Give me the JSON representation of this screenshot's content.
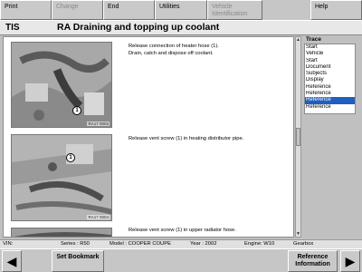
{
  "toolbar": {
    "buttons": [
      {
        "label": "Print",
        "enabled": true
      },
      {
        "label": "Change",
        "enabled": false
      },
      {
        "label": "End",
        "enabled": true
      },
      {
        "label": "Utilities",
        "enabled": true
      },
      {
        "label": "Vehicle Identification",
        "enabled": false
      },
      {
        "label": "Help",
        "enabled": true
      }
    ]
  },
  "header": {
    "app": "TIS",
    "title": "RA  Draining and topping up coolant"
  },
  "steps": [
    {
      "text": "Release connection of heater hose (1).\nDrain, catch and dispose off coolant.",
      "callout": "1",
      "ref": "RA17 0003"
    },
    {
      "text": "Release vent screw (1) in heating distributor pipe.",
      "callout": "1",
      "ref": "RA17 0004"
    },
    {
      "text": "Release vent screw (1) in upper radiator hose."
    }
  ],
  "trace": {
    "label": "Trace",
    "items": [
      "Start",
      "Vehicle",
      "Start",
      "Document",
      "Subjects",
      "Display",
      "Reference",
      "Reference",
      "Reference",
      "Reference"
    ],
    "selected_index": 8
  },
  "status": {
    "vin": "VIN:",
    "series": "Series : R50",
    "model": "Model : COOPER COUPE",
    "year": "Year : 2002",
    "engine": "Engine: W10",
    "gearbox": "Gearbox"
  },
  "bottombar": {
    "set_bookmark": "Set Bookmark",
    "reference_information": "Reference Information",
    "prev_icon": "arrow-left-icon",
    "next_icon": "arrow-right-icon"
  }
}
